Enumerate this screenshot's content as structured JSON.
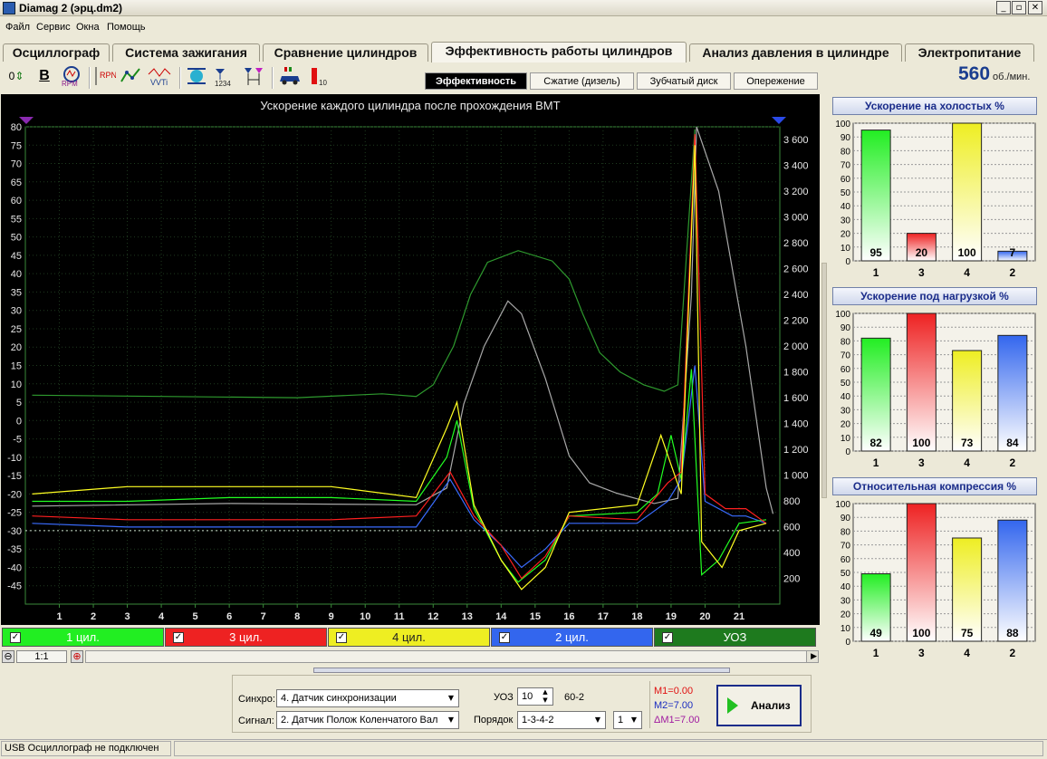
{
  "window": {
    "title": "Diamag 2 (эрц.dm2)",
    "min": "_",
    "max": "▫",
    "close": "✕"
  },
  "menu": [
    "Файл",
    "Сервис",
    "Окна",
    "Помощь"
  ],
  "main_tabs": [
    "Осциллограф",
    "Система зажигания",
    "Сравнение цилиндров",
    "Эффективность работы цилиндров",
    "Анализ давления в цилиндре",
    "Электропитание"
  ],
  "toolbar": {
    "zero": "0",
    "bold": "B",
    "rpm": "RPM",
    "rpn": "RPN",
    "vvti": "VVTi",
    "order_digits": "1234",
    "car_label": "10"
  },
  "sub_tabs": [
    "Эффективность",
    "Сжатие (дизель)",
    "Зубчатый диск",
    "Опережение"
  ],
  "rpm": {
    "value": "560",
    "unit": "об./мин."
  },
  "chart_data": {
    "type": "line",
    "title": "Ускорение каждого цилиндра после прохождения ВМТ",
    "x_ticks": [
      "1",
      "2",
      "3",
      "4",
      "5",
      "6",
      "7",
      "8",
      "9",
      "10",
      "11",
      "12",
      "13",
      "14",
      "15",
      "16",
      "17",
      "18",
      "19",
      "20",
      "21"
    ],
    "y_left_ticks": [
      "80",
      "75",
      "70",
      "65",
      "60",
      "55",
      "50",
      "45",
      "40",
      "35",
      "30",
      "25",
      "20",
      "15",
      "10",
      "5",
      "0",
      "-5",
      "-10",
      "-15",
      "-20",
      "-25",
      "-30",
      "-35",
      "-40",
      "-45"
    ],
    "y_right_ticks": [
      "3 600",
      "3 400",
      "3 200",
      "3 000",
      "2 800",
      "2 600",
      "2 400",
      "2 200",
      "2 000",
      "1 800",
      "1 600",
      "1 400",
      "1 200",
      "1 000",
      "800",
      "600",
      "400",
      "200"
    ],
    "ylim_left": [
      -50,
      80
    ],
    "ylim_right": [
      0,
      3700
    ],
    "xlim": [
      0.0,
      22.2
    ],
    "reference_y": -30,
    "series": [
      {
        "name": "1 цил.",
        "color": "#22ff22",
        "axis": "left",
        "points": [
          [
            0.2,
            -22
          ],
          [
            3,
            -22
          ],
          [
            6,
            -21
          ],
          [
            9,
            -21
          ],
          [
            11.5,
            -22
          ],
          [
            12.4,
            -10
          ],
          [
            12.7,
            0
          ],
          [
            13.2,
            -24
          ],
          [
            14.0,
            -38
          ],
          [
            14.5,
            -44
          ],
          [
            15.3,
            -38
          ],
          [
            16,
            -26
          ],
          [
            18,
            -25
          ],
          [
            18.6,
            -20
          ],
          [
            19.0,
            -4
          ],
          [
            19.3,
            -16
          ],
          [
            19.6,
            14
          ],
          [
            19.9,
            -42
          ],
          [
            20.4,
            -38
          ],
          [
            21,
            -28
          ],
          [
            21.8,
            -27
          ]
        ]
      },
      {
        "name": "3 цил.",
        "color": "#ff2020",
        "axis": "left",
        "points": [
          [
            0.2,
            -26
          ],
          [
            3,
            -27
          ],
          [
            6,
            -27
          ],
          [
            9,
            -27
          ],
          [
            11.5,
            -26
          ],
          [
            12.5,
            -14
          ],
          [
            13.2,
            -26
          ],
          [
            14.0,
            -34
          ],
          [
            14.6,
            -43
          ],
          [
            15.3,
            -37
          ],
          [
            16,
            -26
          ],
          [
            18,
            -27
          ],
          [
            18.9,
            -17
          ],
          [
            19.3,
            -14
          ],
          [
            19.7,
            78
          ],
          [
            20.0,
            -20
          ],
          [
            20.6,
            -24
          ],
          [
            21.2,
            -24
          ],
          [
            21.8,
            -28
          ]
        ]
      },
      {
        "name": "4 цил.",
        "color": "#ffff22",
        "axis": "left",
        "points": [
          [
            0.2,
            -20
          ],
          [
            3,
            -18
          ],
          [
            6,
            -18
          ],
          [
            9,
            -18
          ],
          [
            11.5,
            -21
          ],
          [
            12.4,
            -2
          ],
          [
            12.7,
            5
          ],
          [
            13.2,
            -23
          ],
          [
            14.0,
            -38
          ],
          [
            14.6,
            -46
          ],
          [
            15.3,
            -40
          ],
          [
            16,
            -25
          ],
          [
            18,
            -23
          ],
          [
            18.7,
            -4
          ],
          [
            19.0,
            -12
          ],
          [
            19.3,
            -20
          ],
          [
            19.7,
            75
          ],
          [
            19.9,
            -33
          ],
          [
            20.5,
            -40
          ],
          [
            21,
            -30
          ],
          [
            21.8,
            -28
          ]
        ]
      },
      {
        "name": "2 цил.",
        "color": "#3a6cff",
        "axis": "left",
        "points": [
          [
            0.2,
            -28
          ],
          [
            3,
            -29
          ],
          [
            6,
            -29
          ],
          [
            9,
            -29
          ],
          [
            11.5,
            -29
          ],
          [
            12.5,
            -16
          ],
          [
            13.2,
            -27
          ],
          [
            14.0,
            -34
          ],
          [
            14.6,
            -40
          ],
          [
            15.3,
            -35
          ],
          [
            16,
            -28
          ],
          [
            18,
            -28
          ],
          [
            18.9,
            -22
          ],
          [
            19.3,
            -16
          ],
          [
            19.7,
            15
          ],
          [
            20.0,
            -22
          ],
          [
            20.8,
            -26
          ],
          [
            21.2,
            -26
          ],
          [
            21.8,
            -28
          ]
        ]
      },
      {
        "name": "УОЗ",
        "color": "#2e9a2e",
        "axis": "right",
        "points": [
          [
            0.2,
            1620
          ],
          [
            4,
            1610
          ],
          [
            8,
            1600
          ],
          [
            10.5,
            1630
          ],
          [
            11.5,
            1610
          ],
          [
            12.0,
            1700
          ],
          [
            12.6,
            2000
          ],
          [
            13.1,
            2400
          ],
          [
            13.6,
            2650
          ],
          [
            14.5,
            2740
          ],
          [
            15.5,
            2660
          ],
          [
            16.0,
            2520
          ],
          [
            16.4,
            2250
          ],
          [
            16.9,
            1950
          ],
          [
            17.5,
            1800
          ],
          [
            18.2,
            1700
          ],
          [
            18.8,
            1650
          ],
          [
            19.2,
            1700
          ],
          [
            19.7,
            3680
          ]
        ]
      },
      {
        "name": "об./мин.",
        "color": "#a8a8a8",
        "axis": "right",
        "points": [
          [
            0.2,
            760
          ],
          [
            6,
            780
          ],
          [
            11.5,
            770
          ],
          [
            12.4,
            900
          ],
          [
            12.9,
            1550
          ],
          [
            13.5,
            2000
          ],
          [
            14.2,
            2350
          ],
          [
            14.6,
            2250
          ],
          [
            15.3,
            1750
          ],
          [
            16.0,
            1150
          ],
          [
            16.6,
            940
          ],
          [
            17.4,
            860
          ],
          [
            18.5,
            780
          ],
          [
            19.2,
            820
          ],
          [
            19.6,
            2400
          ],
          [
            19.75,
            3700
          ],
          [
            20.4,
            3200
          ],
          [
            21.2,
            2000
          ],
          [
            21.8,
            900
          ],
          [
            22.0,
            700
          ]
        ]
      }
    ]
  },
  "legend": [
    {
      "label": "1 цил.",
      "color": "#22ee22",
      "checked": "✓"
    },
    {
      "label": "3 цил.",
      "color": "#ee2222",
      "checked": "✓"
    },
    {
      "label": "4 цил.",
      "color": "#eeee22",
      "checked": "✓"
    },
    {
      "label": "2 цил.",
      "color": "#3366ee",
      "checked": "✓"
    },
    {
      "label": "УОЗ",
      "color": "#1e7a1e",
      "checked": "✓"
    }
  ],
  "scroll": {
    "zoom_out": "⊖",
    "ratio": "1:1",
    "zoom_in": "⊕"
  },
  "panels": [
    {
      "title": "Ускорение на холостых %",
      "y_ticks": [
        "100",
        "90",
        "80",
        "70",
        "60",
        "50",
        "40",
        "30",
        "20",
        "10",
        "0"
      ],
      "bars": [
        {
          "cyl": "1",
          "value": 95,
          "label": "95",
          "color": "#22ee22"
        },
        {
          "cyl": "3",
          "value": 20,
          "label": "20",
          "color": "#ee2222"
        },
        {
          "cyl": "4",
          "value": 100,
          "label": "100",
          "color": "#eeee22"
        },
        {
          "cyl": "2",
          "value": 7,
          "label": "7",
          "color": "#3366ee"
        }
      ]
    },
    {
      "title": "Ускорение под нагрузкой %",
      "y_ticks": [
        "100",
        "90",
        "80",
        "70",
        "60",
        "50",
        "40",
        "30",
        "20",
        "10",
        "0"
      ],
      "bars": [
        {
          "cyl": "1",
          "value": 82,
          "label": "82",
          "color": "#22ee22"
        },
        {
          "cyl": "3",
          "value": 100,
          "label": "100",
          "color": "#ee2222"
        },
        {
          "cyl": "4",
          "value": 73,
          "label": "73",
          "color": "#eeee22"
        },
        {
          "cyl": "2",
          "value": 84,
          "label": "84",
          "color": "#3366ee"
        }
      ]
    },
    {
      "title": "Относительная компрессия %",
      "y_ticks": [
        "100",
        "90",
        "80",
        "70",
        "60",
        "50",
        "40",
        "30",
        "20",
        "10",
        "0"
      ],
      "bars": [
        {
          "cyl": "1",
          "value": 49,
          "label": "49",
          "color": "#22ee22"
        },
        {
          "cyl": "3",
          "value": 100,
          "label": "100",
          "color": "#ee2222"
        },
        {
          "cyl": "4",
          "value": 75,
          "label": "75",
          "color": "#eeee22"
        },
        {
          "cyl": "2",
          "value": 88,
          "label": "88",
          "color": "#3366ee"
        }
      ]
    }
  ],
  "bottom": {
    "sync_label": "Синхро:",
    "sync_value": "4.  Датчик синхронизации",
    "signal_label": "Сигнал:",
    "signal_value": "2.  Датчик Полож Коленчатого Вал",
    "uoz_label": "УОЗ",
    "uoz_value": "10",
    "wheel": "60-2",
    "order_label": "Порядок",
    "order_value": "1-3-4-2",
    "order_num": "1",
    "m1": "M1=0.00",
    "m2": "M2=7.00",
    "dm1": "ΔM1=7.00",
    "analyze": "Анализ"
  },
  "status": "USB Осциллограф не подключен"
}
